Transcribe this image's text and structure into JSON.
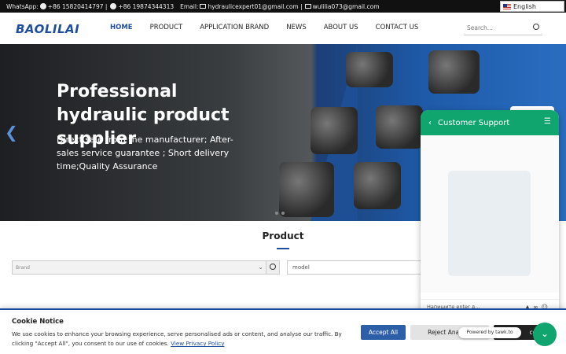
{
  "topbar": {
    "whatsapp_label": "WhatsApp:",
    "phone1": "+86 15820414797 |",
    "phone2": "+86 19874344313",
    "email_label": "Email:",
    "email1": "hydraulicexpert01@gmail.com |",
    "email2": "wulilia073@gmail.com",
    "language": "English"
  },
  "nav": {
    "logo": "BAOLILAI",
    "items": [
      "HOME",
      "PRODUCT",
      "APPLICATION BRAND",
      "NEWS",
      "ABOUT US",
      "CONTACT US"
    ],
    "search_placeholder": "Search..."
  },
  "hero": {
    "title": "Professional hydraulic product supplier",
    "subtitle": "Direct sale from the manufacturer; After-sales service guarantee ; Short delivery time;Quality Assurance"
  },
  "product": {
    "title": "Product",
    "brand_placeholder": "Brand",
    "model_placeholder": "model"
  },
  "chat": {
    "title": "Customer Support",
    "input_placeholder": "Напишите enter д...",
    "powered": "Powered by tawk.to"
  },
  "cookie": {
    "title": "Cookie Notice",
    "text": "We use cookies to enhance your browsing experience, serve personalised ads or content, and analyse our traffic. By clicking \"Accept All\", you consent to our use of cookies.",
    "link": "View Privacy Policy",
    "accept": "Accept All",
    "reject": "Reject Analytic",
    "necessary": "cess"
  },
  "colors": {
    "brand_blue": "#1d4ea0",
    "chat_green": "#10a56e"
  }
}
